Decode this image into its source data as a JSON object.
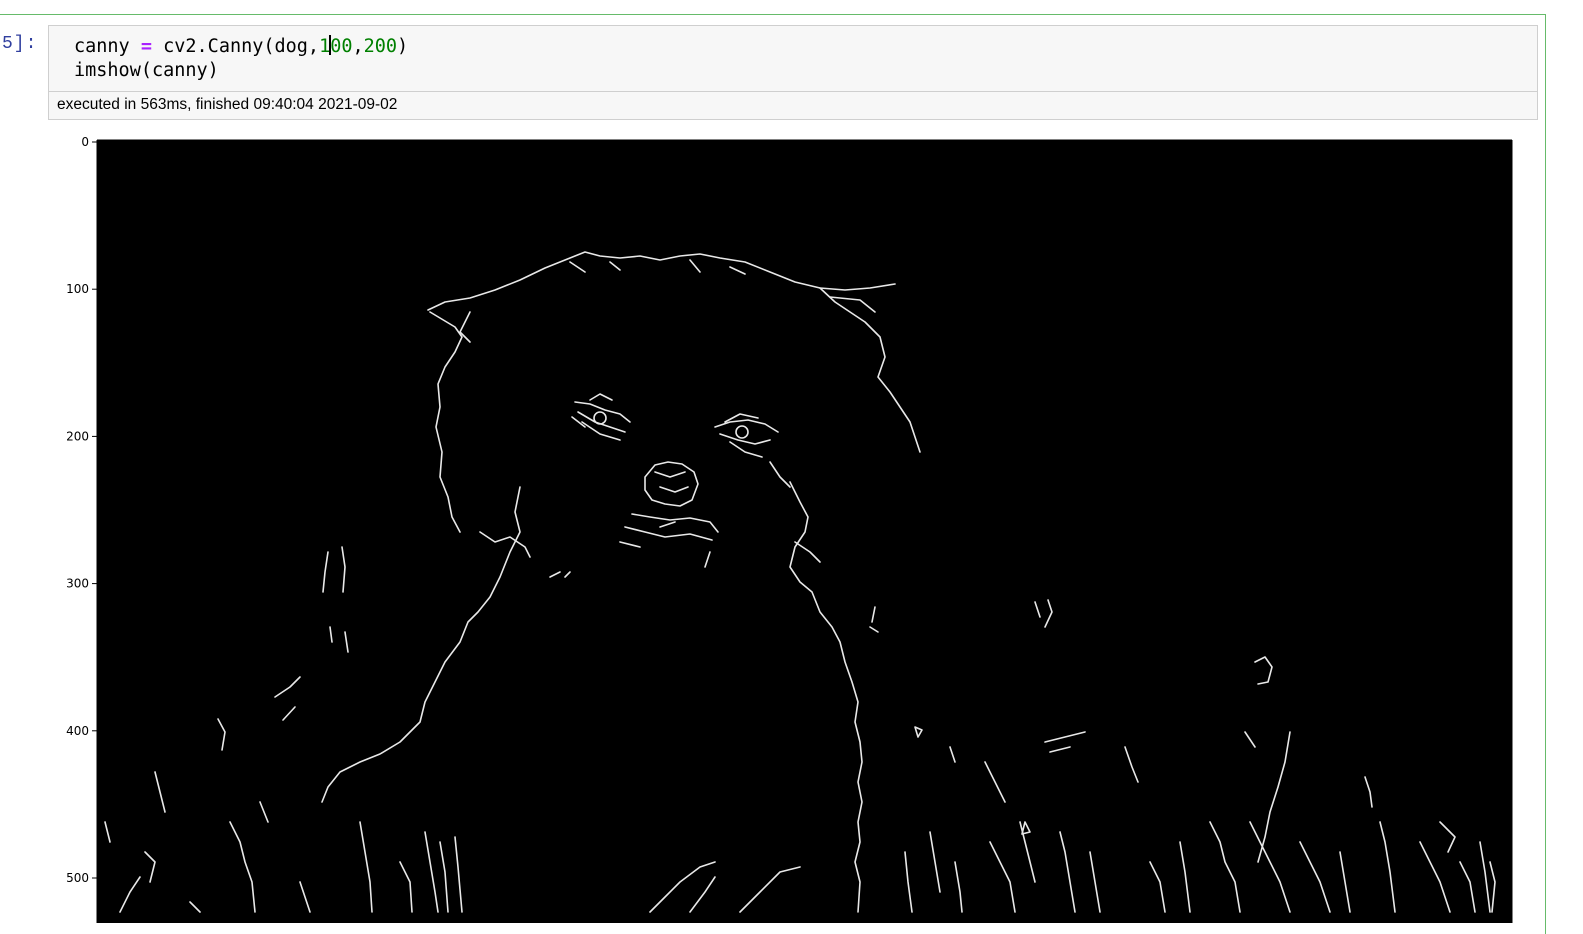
{
  "cell": {
    "prompt": "5]:",
    "code": {
      "line1": {
        "var": "canny",
        "op": "=",
        "call": "cv2.Canny(dog,",
        "arg1_a": "1",
        "arg1_b": "00",
        "sep": ",",
        "arg2": "200",
        "close": ")"
      },
      "line2": "imshow(canny)"
    },
    "execution_info": "executed in 563ms, finished 09:40:04 2021-09-02"
  },
  "output_plot": {
    "image_description_icon": "edge-detection-image",
    "background_color": "#000000",
    "edge_color": "#ffffff",
    "y_ticks": [
      "0",
      "100",
      "200",
      "300",
      "400",
      "500"
    ]
  }
}
